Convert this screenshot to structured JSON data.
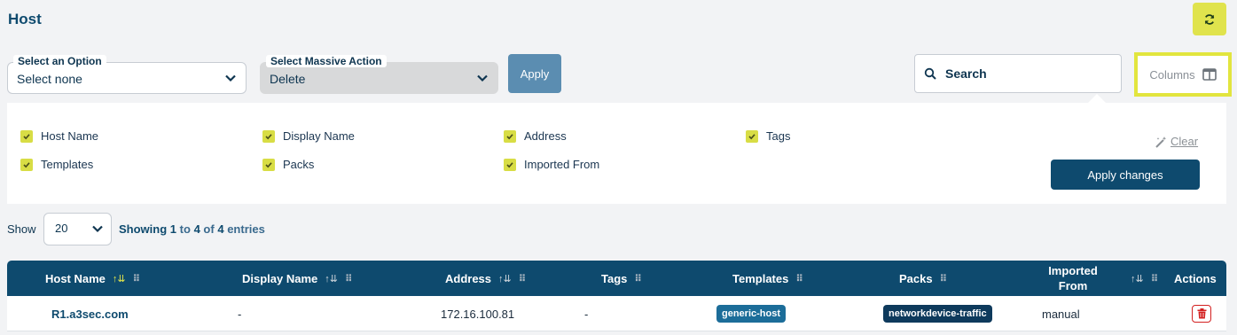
{
  "page": {
    "title": "Host"
  },
  "toolbar": {
    "option_select": {
      "legend": "Select an Option",
      "value": "Select none"
    },
    "massive_action": {
      "legend": "Select Massive Action",
      "value": "Delete"
    },
    "apply_label": "Apply",
    "search_placeholder": "Search",
    "columns_label": "Columns"
  },
  "columns_panel": {
    "items": [
      {
        "label": "Host Name",
        "checked": true
      },
      {
        "label": "Display Name",
        "checked": true
      },
      {
        "label": "Address",
        "checked": true
      },
      {
        "label": "Tags",
        "checked": true
      },
      {
        "label": "Templates",
        "checked": true
      },
      {
        "label": "Packs",
        "checked": true
      },
      {
        "label": "Imported From",
        "checked": true
      }
    ],
    "clear_label": "Clear",
    "apply_changes_label": "Apply changes"
  },
  "pagination": {
    "show_label": "Show",
    "page_size": "20",
    "showing_prefix": "Showing",
    "from": "1",
    "to_word": "to",
    "to": "4",
    "of_word": "of",
    "total": "4",
    "suffix": "entries"
  },
  "table": {
    "headers": {
      "host_name": "Host Name",
      "display_name": "Display Name",
      "address": "Address",
      "tags": "Tags",
      "templates": "Templates",
      "packs": "Packs",
      "imported_from_1": "Imported",
      "imported_from_2": "From",
      "actions": "Actions"
    },
    "rows": [
      {
        "host_name": "R1.a3sec.com",
        "display_name": "-",
        "address": "172.16.100.81",
        "tags": "-",
        "templates": "generic-host",
        "packs": "networkdevice-traffic",
        "imported_from": "manual"
      }
    ]
  },
  "colors": {
    "primary": "#0e4a6e",
    "accent": "#e0e34d",
    "apply": "#5b8db1",
    "danger": "#d32020"
  },
  "icons": {
    "refresh": "refresh-icon",
    "chevron": "chevron-down-icon",
    "search": "search-icon",
    "columns": "columns-icon",
    "check": "check-icon",
    "clear": "magic-wand-icon",
    "sort": "sort-icon",
    "grip": "drag-handle-icon",
    "trash": "trash-icon"
  }
}
